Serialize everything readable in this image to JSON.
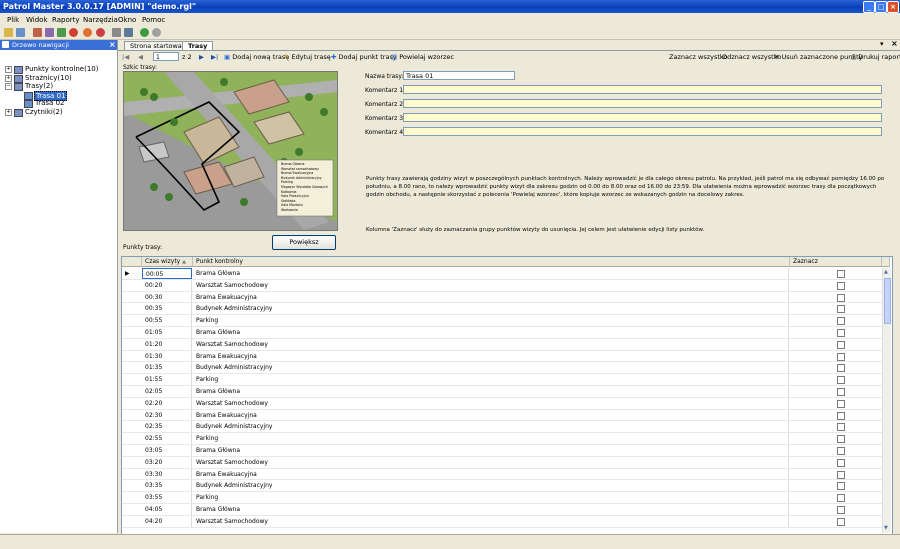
{
  "window": {
    "title": "Patrol Master 3.0.0.17  [ADMIN] \"demo.rgl\""
  },
  "menu": [
    "Plik",
    "Widok",
    "Raporty",
    "Narzędzia",
    "Okno",
    "Pomoc"
  ],
  "nav": {
    "title": "Drzewo nawigacji",
    "items": [
      {
        "label": "Punkty kontrolne(10)",
        "level": 0,
        "expanded": false
      },
      {
        "label": "Strażnicy(10)",
        "level": 0,
        "expanded": false
      },
      {
        "label": "Trasy(2)",
        "level": 0,
        "expanded": true
      },
      {
        "label": "Trasa 01",
        "level": 1,
        "selected": true
      },
      {
        "label": "Trasa 02",
        "level": 1
      },
      {
        "label": "Czytniki(2)",
        "level": 0,
        "expanded": false
      }
    ]
  },
  "tabs": [
    {
      "label": "Strona startowa"
    },
    {
      "label": "Trasy",
      "active": true
    }
  ],
  "navigator": {
    "page": "1",
    "of": "z 2"
  },
  "actions": {
    "add_route": "Dodaj nową trasę",
    "edit_route": "Edytuj trasę",
    "add_point": "Dodaj punkt trasy",
    "copy_template": "Powielaj wzorzec",
    "select_all": "Zaznacz wszystko",
    "deselect_all": "Odznacz wszystko",
    "delete_selected": "Usuń zaznaczone punkty",
    "print": "Drukuj raport"
  },
  "form": {
    "sketch_label": "Szkic trasy:",
    "route_name_label": "Nazwa trasy:",
    "route_name_value": "Trasa 01",
    "comment1_label": "Komentarz 1:",
    "comment2_label": "Komentarz 2:",
    "comment3_label": "Komentarz 3:",
    "comment4_label": "Komentarz 4:",
    "enlarge_button": "Powiększ",
    "points_label": "Punkty trasy:",
    "info1": "Punkty trasy zawierają godziny wizyt w poszczególnych punktach kontrolnych. Należy wprowadzić je dla całego okresu patrolu.  Na przykład, jeśli patrol ma się odbywać pomiędzy 16.00 po południu, a 8.00 rano, to należy wprowadzić punkty wizyt dla zakresu godzin od 0.00 do 8.00 oraz od 16.00 do 23:59. Dla ułatwienia można wprowadzić wzorzec trasy dla początkowych godzin obchodu, a następnie skorzystać z polecenia 'Powielaj wzorzec', które kopiuje wzorzec ze wskazanych godzin na docelowy zakres.",
    "info2": "Kolumna 'Zaznacz' służy do zaznaczania grupy punktów wizyty do usunięcia. Jej celem jest ułatwienie edycji listy punktów."
  },
  "map_legend": [
    "Brama Główna",
    "Warsztat samochodowy",
    "Brama Ewakuacyjna",
    "Budynek Administracyjny",
    "Parking",
    "Magazyn Wyrobów Gotowych",
    "Kotłownia",
    "Hala Produkcyjna",
    "Stołówka",
    "Hala Montażu",
    "Wartownia"
  ],
  "grid": {
    "columns": {
      "time": "Czas wizyty",
      "point": "Punkt kontrolny",
      "mark": "Zaznacz"
    },
    "rows": [
      {
        "time": "00:05",
        "point": "Brama Główna"
      },
      {
        "time": "00:20",
        "point": "Warsztat Samochodowy"
      },
      {
        "time": "00:30",
        "point": "Brama Ewakuacyjna"
      },
      {
        "time": "00:35",
        "point": "Budynek Administracyjny"
      },
      {
        "time": "00:55",
        "point": "Parking"
      },
      {
        "time": "01:05",
        "point": "Brama Główna"
      },
      {
        "time": "01:20",
        "point": "Warsztat Samochodowy"
      },
      {
        "time": "01:30",
        "point": "Brama Ewakuacyjna"
      },
      {
        "time": "01:35",
        "point": "Budynek Administracyjny"
      },
      {
        "time": "01:55",
        "point": "Parking"
      },
      {
        "time": "02:05",
        "point": "Brama Główna"
      },
      {
        "time": "02:20",
        "point": "Warsztat Samochodowy"
      },
      {
        "time": "02:30",
        "point": "Brama Ewakuacyjna"
      },
      {
        "time": "02:35",
        "point": "Budynek Administracyjny"
      },
      {
        "time": "02:55",
        "point": "Parking"
      },
      {
        "time": "03:05",
        "point": "Brama Główna"
      },
      {
        "time": "03:20",
        "point": "Warsztat Samochodowy"
      },
      {
        "time": "03:30",
        "point": "Brama Ewakuacyjna"
      },
      {
        "time": "03:35",
        "point": "Budynek Administracyjny"
      },
      {
        "time": "03:55",
        "point": "Parking"
      },
      {
        "time": "04:05",
        "point": "Brama Główna"
      },
      {
        "time": "04:20",
        "point": "Warsztat Samochodowy"
      }
    ]
  },
  "colors": {
    "title_bar": "#0a3fb8",
    "nav_header": "#3a6fd8",
    "comment_field": "#fffbd0",
    "selection": "#316ac5"
  }
}
